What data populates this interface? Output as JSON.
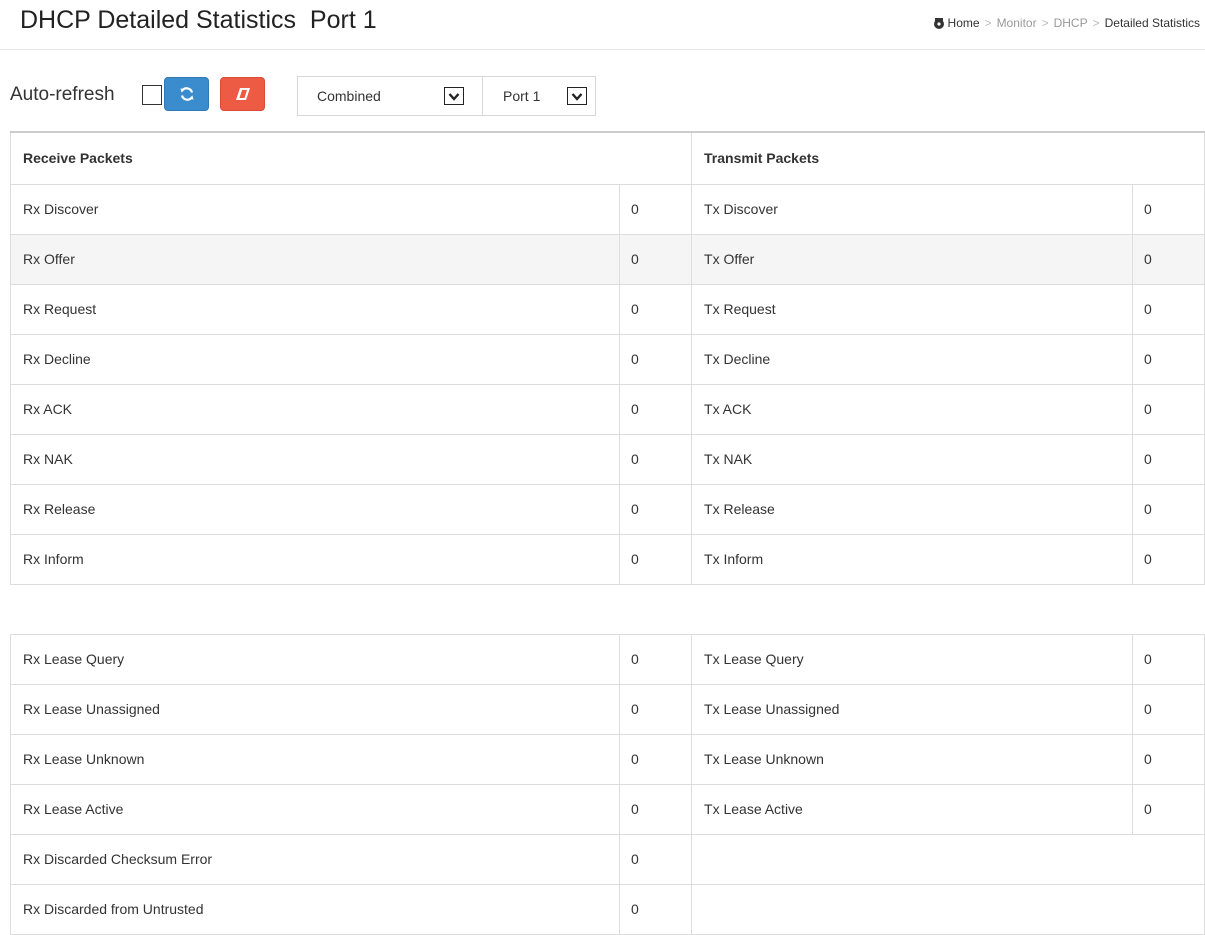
{
  "header": {
    "title": "DHCP Detailed Statistics  Port 1",
    "breadcrumb": {
      "home": "Home",
      "items": [
        "Monitor",
        "DHCP",
        "Detailed Statistics"
      ],
      "separator": ">"
    }
  },
  "toolbar": {
    "auto_refresh_label": "Auto-refresh",
    "auto_refresh_checked": false,
    "refresh_icon": "refresh-icon",
    "clear_icon": "eraser-icon",
    "mode_select": {
      "value": "Combined"
    },
    "port_select": {
      "value": "Port 1"
    }
  },
  "colors": {
    "refresh_button": "#3a8ccd",
    "clear_button": "#ee5b45",
    "row_stripe": "#f5f5f5"
  },
  "table": {
    "receive_header": "Receive Packets",
    "transmit_header": "Transmit Packets",
    "group1": [
      {
        "rx_label": "Rx Discover",
        "rx_value": "0",
        "tx_label": "Tx Discover",
        "tx_value": "0"
      },
      {
        "rx_label": "Rx Offer",
        "rx_value": "0",
        "tx_label": "Tx Offer",
        "tx_value": "0"
      },
      {
        "rx_label": "Rx Request",
        "rx_value": "0",
        "tx_label": "Tx Request",
        "tx_value": "0"
      },
      {
        "rx_label": "Rx Decline",
        "rx_value": "0",
        "tx_label": "Tx Decline",
        "tx_value": "0"
      },
      {
        "rx_label": "Rx ACK",
        "rx_value": "0",
        "tx_label": "Tx ACK",
        "tx_value": "0"
      },
      {
        "rx_label": "Rx NAK",
        "rx_value": "0",
        "tx_label": "Tx NAK",
        "tx_value": "0"
      },
      {
        "rx_label": "Rx Release",
        "rx_value": "0",
        "tx_label": "Tx Release",
        "tx_value": "0"
      },
      {
        "rx_label": "Rx Inform",
        "rx_value": "0",
        "tx_label": "Tx Inform",
        "tx_value": "0"
      }
    ],
    "group2": [
      {
        "rx_label": "Rx Lease Query",
        "rx_value": "0",
        "tx_label": "Tx Lease Query",
        "tx_value": "0"
      },
      {
        "rx_label": "Rx Lease Unassigned",
        "rx_value": "0",
        "tx_label": "Tx Lease Unassigned",
        "tx_value": "0"
      },
      {
        "rx_label": "Rx Lease Unknown",
        "rx_value": "0",
        "tx_label": "Tx Lease Unknown",
        "tx_value": "0"
      },
      {
        "rx_label": "Rx Lease Active",
        "rx_value": "0",
        "tx_label": "Tx Lease Active",
        "tx_value": "0"
      },
      {
        "rx_label": "Rx Discarded Checksum Error",
        "rx_value": "0"
      },
      {
        "rx_label": "Rx Discarded from Untrusted",
        "rx_value": "0"
      }
    ]
  }
}
